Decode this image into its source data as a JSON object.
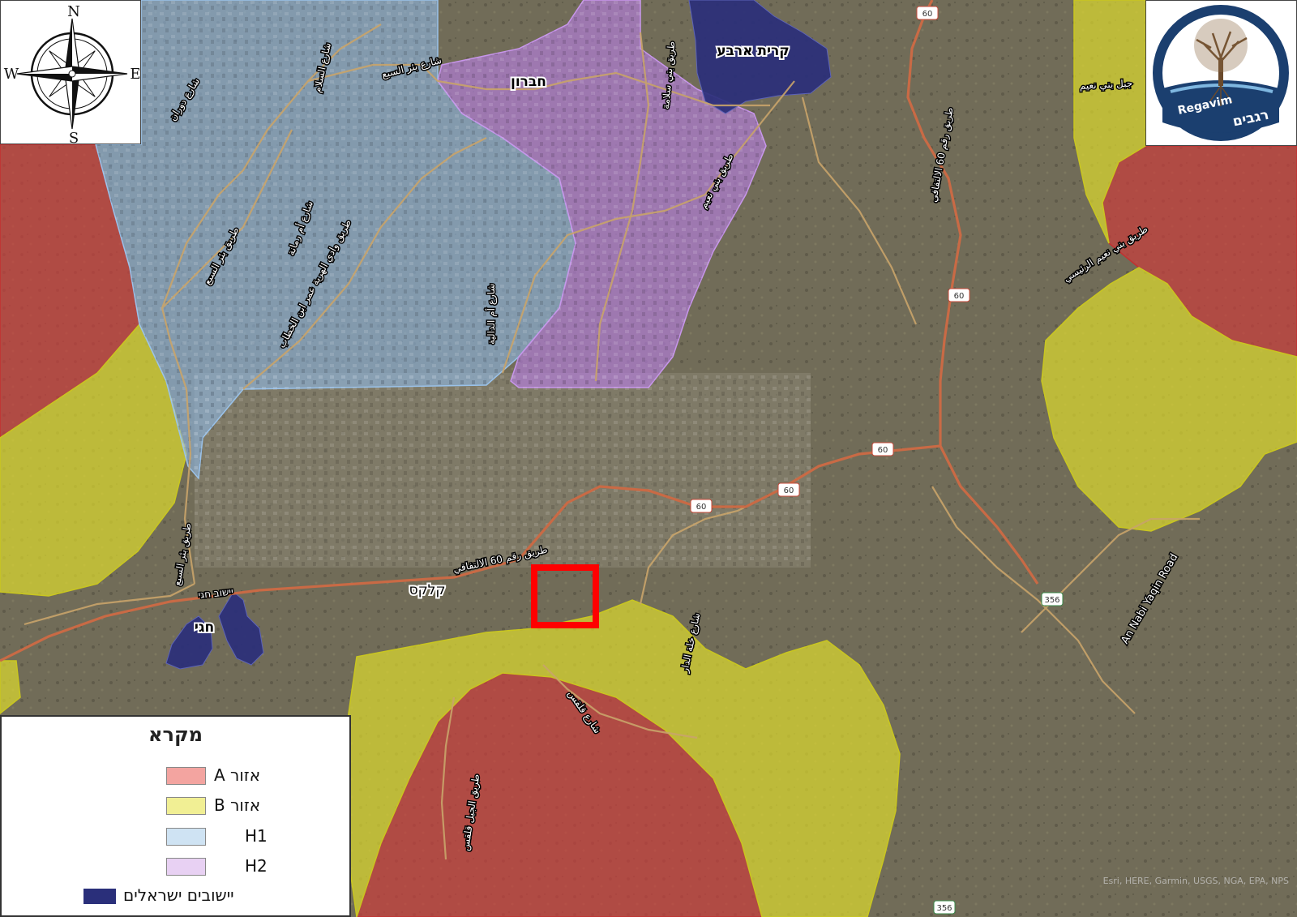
{
  "map": {
    "colors": {
      "zone_a": "#d23a3a",
      "zone_b": "#e1de2c",
      "h1": "#8fb9e6",
      "h2": "#b77fe0",
      "israeli_settlements": "#2a2f7a",
      "roads": "#c9a46a",
      "route60": "#c96a45",
      "target_box": "#ff0000"
    },
    "place_labels": {
      "hebron": "חברון",
      "kiryat_arba": "קרית ארבע",
      "kalkas": "קלקס",
      "hagai": "חגי"
    },
    "road_labels": {
      "bir_al_saba_st": "شارع بئر السبع",
      "al_salam_st": "شارع السلام",
      "duran_st": "شارع دوران",
      "bir_al_saba_rd": "طريق بئر السبع",
      "umm_rummana_st": "شارع أم رمانة",
      "wadi_al_haria": "طريق وادي الهرية عمر ابن الخطاب",
      "umm_al_dalia_st": "شارع أم الدالية",
      "bani_naim_rd": "طريق بني نعيم",
      "bani_naim_rd2": "طريق بني سلامة",
      "route60_agreement": "طريق رقم 60 الالتفافي",
      "route60_agreement_north": "طريق رقم 60 الالتفافي",
      "bani_naim_main": "طريق بني نعيم الرئيسي",
      "bani_naim_ne": "جبل بني نعيم",
      "bir_al_saba_sw": "طريق بئر السبع",
      "yeshuv_hagai": "יישוב חגי",
      "khallet_al_dar": "شارع خلة الدار",
      "qalqas_st": "شارع قلقس",
      "jabal_qalqas": "طريق الجبل قلقس",
      "an_nabi_yaqin": "An Nabi Yaqin Road"
    },
    "route_shields": [
      "60",
      "60",
      "60",
      "60",
      "60",
      "356",
      "356"
    ],
    "copyright": "Esri, HERE, Garmin, USGS, NGA, EPA, NPS"
  },
  "compass": {
    "north": "N",
    "south": "S",
    "east": "E",
    "west": "W"
  },
  "logo": {
    "hebrew": "רגבים",
    "latin": "Regavim"
  },
  "legend": {
    "title": "מקרא",
    "items": [
      {
        "label": "אזור A",
        "color": "#f3a4a0"
      },
      {
        "label": "אזור B",
        "color": "#f1ef94"
      },
      {
        "label": "H1",
        "color": "#cfe3f3"
      },
      {
        "label": "H2",
        "color": "#e8d1f3"
      },
      {
        "label": "יישובים ישראלים",
        "color": "#2a2f7a"
      }
    ]
  }
}
